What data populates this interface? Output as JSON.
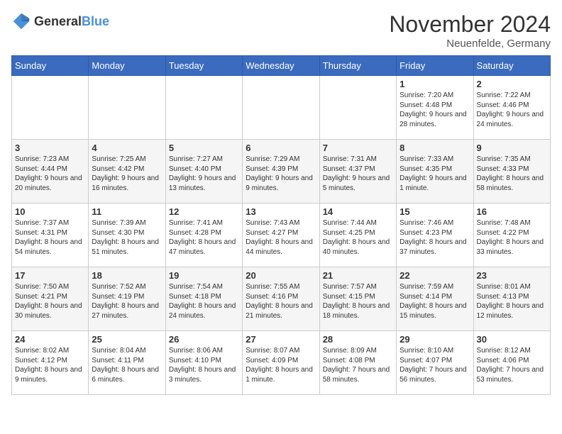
{
  "logo": {
    "general": "General",
    "blue": "Blue"
  },
  "title": "November 2024",
  "location": "Neuenfelde, Germany",
  "days_of_week": [
    "Sunday",
    "Monday",
    "Tuesday",
    "Wednesday",
    "Thursday",
    "Friday",
    "Saturday"
  ],
  "weeks": [
    [
      {
        "day": "",
        "info": ""
      },
      {
        "day": "",
        "info": ""
      },
      {
        "day": "",
        "info": ""
      },
      {
        "day": "",
        "info": ""
      },
      {
        "day": "",
        "info": ""
      },
      {
        "day": "1",
        "info": "Sunrise: 7:20 AM\nSunset: 4:48 PM\nDaylight: 9 hours and 28 minutes."
      },
      {
        "day": "2",
        "info": "Sunrise: 7:22 AM\nSunset: 4:46 PM\nDaylight: 9 hours and 24 minutes."
      }
    ],
    [
      {
        "day": "3",
        "info": "Sunrise: 7:23 AM\nSunset: 4:44 PM\nDaylight: 9 hours and 20 minutes."
      },
      {
        "day": "4",
        "info": "Sunrise: 7:25 AM\nSunset: 4:42 PM\nDaylight: 9 hours and 16 minutes."
      },
      {
        "day": "5",
        "info": "Sunrise: 7:27 AM\nSunset: 4:40 PM\nDaylight: 9 hours and 13 minutes."
      },
      {
        "day": "6",
        "info": "Sunrise: 7:29 AM\nSunset: 4:39 PM\nDaylight: 9 hours and 9 minutes."
      },
      {
        "day": "7",
        "info": "Sunrise: 7:31 AM\nSunset: 4:37 PM\nDaylight: 9 hours and 5 minutes."
      },
      {
        "day": "8",
        "info": "Sunrise: 7:33 AM\nSunset: 4:35 PM\nDaylight: 9 hours and 1 minute."
      },
      {
        "day": "9",
        "info": "Sunrise: 7:35 AM\nSunset: 4:33 PM\nDaylight: 8 hours and 58 minutes."
      }
    ],
    [
      {
        "day": "10",
        "info": "Sunrise: 7:37 AM\nSunset: 4:31 PM\nDaylight: 8 hours and 54 minutes."
      },
      {
        "day": "11",
        "info": "Sunrise: 7:39 AM\nSunset: 4:30 PM\nDaylight: 8 hours and 51 minutes."
      },
      {
        "day": "12",
        "info": "Sunrise: 7:41 AM\nSunset: 4:28 PM\nDaylight: 8 hours and 47 minutes."
      },
      {
        "day": "13",
        "info": "Sunrise: 7:43 AM\nSunset: 4:27 PM\nDaylight: 8 hours and 44 minutes."
      },
      {
        "day": "14",
        "info": "Sunrise: 7:44 AM\nSunset: 4:25 PM\nDaylight: 8 hours and 40 minutes."
      },
      {
        "day": "15",
        "info": "Sunrise: 7:46 AM\nSunset: 4:23 PM\nDaylight: 8 hours and 37 minutes."
      },
      {
        "day": "16",
        "info": "Sunrise: 7:48 AM\nSunset: 4:22 PM\nDaylight: 8 hours and 33 minutes."
      }
    ],
    [
      {
        "day": "17",
        "info": "Sunrise: 7:50 AM\nSunset: 4:21 PM\nDaylight: 8 hours and 30 minutes."
      },
      {
        "day": "18",
        "info": "Sunrise: 7:52 AM\nSunset: 4:19 PM\nDaylight: 8 hours and 27 minutes."
      },
      {
        "day": "19",
        "info": "Sunrise: 7:54 AM\nSunset: 4:18 PM\nDaylight: 8 hours and 24 minutes."
      },
      {
        "day": "20",
        "info": "Sunrise: 7:55 AM\nSunset: 4:16 PM\nDaylight: 8 hours and 21 minutes."
      },
      {
        "day": "21",
        "info": "Sunrise: 7:57 AM\nSunset: 4:15 PM\nDaylight: 8 hours and 18 minutes."
      },
      {
        "day": "22",
        "info": "Sunrise: 7:59 AM\nSunset: 4:14 PM\nDaylight: 8 hours and 15 minutes."
      },
      {
        "day": "23",
        "info": "Sunrise: 8:01 AM\nSunset: 4:13 PM\nDaylight: 8 hours and 12 minutes."
      }
    ],
    [
      {
        "day": "24",
        "info": "Sunrise: 8:02 AM\nSunset: 4:12 PM\nDaylight: 8 hours and 9 minutes."
      },
      {
        "day": "25",
        "info": "Sunrise: 8:04 AM\nSunset: 4:11 PM\nDaylight: 8 hours and 6 minutes."
      },
      {
        "day": "26",
        "info": "Sunrise: 8:06 AM\nSunset: 4:10 PM\nDaylight: 8 hours and 3 minutes."
      },
      {
        "day": "27",
        "info": "Sunrise: 8:07 AM\nSunset: 4:09 PM\nDaylight: 8 hours and 1 minute."
      },
      {
        "day": "28",
        "info": "Sunrise: 8:09 AM\nSunset: 4:08 PM\nDaylight: 7 hours and 58 minutes."
      },
      {
        "day": "29",
        "info": "Sunrise: 8:10 AM\nSunset: 4:07 PM\nDaylight: 7 hours and 56 minutes."
      },
      {
        "day": "30",
        "info": "Sunrise: 8:12 AM\nSunset: 4:06 PM\nDaylight: 7 hours and 53 minutes."
      }
    ]
  ]
}
